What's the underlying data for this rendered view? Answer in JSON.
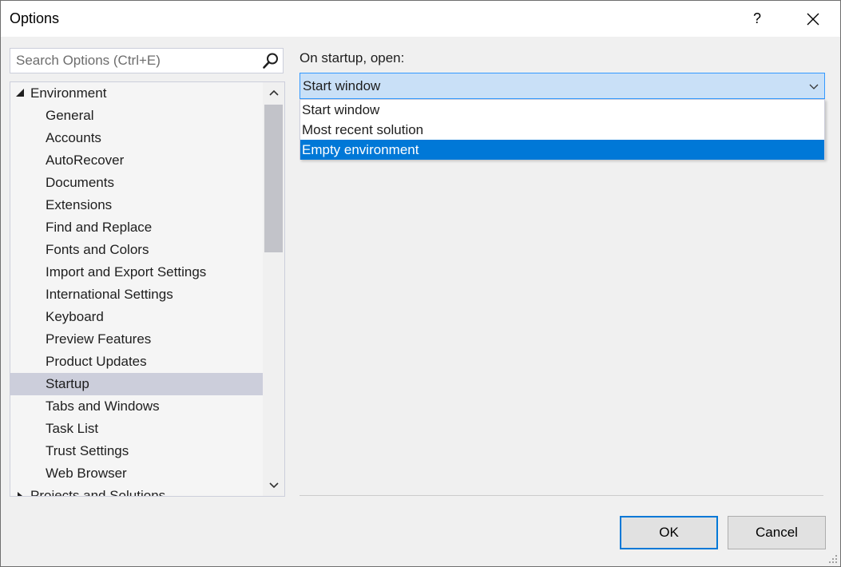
{
  "window": {
    "title": "Options"
  },
  "titlebar": {
    "help_label": "?"
  },
  "search": {
    "placeholder": "Search Options (Ctrl+E)"
  },
  "tree": {
    "root_label": "Environment",
    "items": [
      "General",
      "Accounts",
      "AutoRecover",
      "Documents",
      "Extensions",
      "Find and Replace",
      "Fonts and Colors",
      "Import and Export Settings",
      "International Settings",
      "Keyboard",
      "Preview Features",
      "Product Updates",
      "Startup",
      "Tabs and Windows",
      "Task List",
      "Trust Settings",
      "Web Browser"
    ],
    "selected": "Startup",
    "next_root_label": "Projects and Solutions"
  },
  "startup": {
    "label": "On startup, open:",
    "selected_value": "Start window",
    "options": [
      "Start window",
      "Most recent solution",
      "Empty environment"
    ],
    "highlighted_option": "Empty environment"
  },
  "buttons": {
    "ok_label": "OK",
    "cancel_label": "Cancel"
  },
  "colors": {
    "accent": "#0078d7",
    "selection": "#cccedb",
    "combo_bg": "#c9e0f7"
  }
}
